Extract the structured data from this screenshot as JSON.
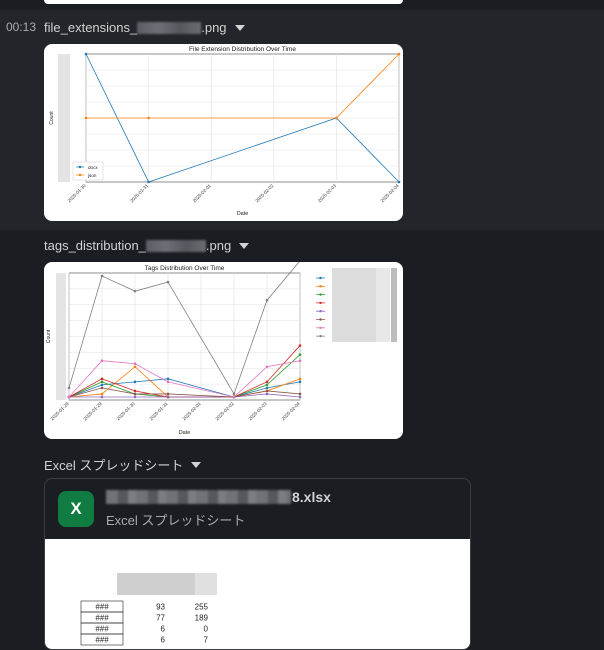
{
  "message": {
    "time": "00:13"
  },
  "files": [
    {
      "name_prefix": "file_extensions_",
      "name_suffix": ".png"
    },
    {
      "name_prefix": "tags_distribution_",
      "name_suffix": ".png"
    }
  ],
  "excel_section_label": "Excel スプレッドシート",
  "excel_card": {
    "name_suffix": "8.xlsx",
    "type_label": "Excel スプレッドシート",
    "icon_letter": "X"
  },
  "excel_preview": {
    "rows": [
      {
        "a": "###",
        "b": "93",
        "c": "255"
      },
      {
        "a": "###",
        "b": "77",
        "c": "189"
      },
      {
        "a": "###",
        "b": "6",
        "c": "0"
      },
      {
        "a": "###",
        "b": "6",
        "c": "7"
      }
    ]
  },
  "colors": {
    "blue": "#1f77b4",
    "orange": "#ff7f0e",
    "green": "#2ca02c",
    "red": "#d62728",
    "purple": "#9467bd",
    "brown": "#8c564b",
    "pink": "#e377c2",
    "gray": "#7f7f7f",
    "excel": "#107c41"
  },
  "chart_data": [
    {
      "type": "line",
      "title": "File Extension Distribution Over Time",
      "xlabel": "Date",
      "ylabel": "Count",
      "x": [
        "2025-01-30",
        "2025-01-31",
        "2025-02-01",
        "2025-02-02",
        "2025-02-03",
        "2025-02-04"
      ],
      "grid": true,
      "legend_position": "bottom-left",
      "ylim": [
        0,
        10
      ],
      "series": [
        {
          "name": "docx",
          "color": "#1f77b4",
          "points": [
            [
              0,
              10
            ],
            [
              1,
              0
            ],
            [
              4,
              5
            ],
            [
              5,
              0
            ]
          ]
        },
        {
          "name": "json",
          "color": "#ff7f0e",
          "points": [
            [
              0,
              5
            ],
            [
              1,
              5
            ],
            [
              4,
              5
            ],
            [
              5,
              10
            ]
          ]
        }
      ]
    },
    {
      "type": "line",
      "title": "Tags Distribution Over Time",
      "xlabel": "Date",
      "ylabel": "Count",
      "x": [
        "2025-01-28",
        "2025-01-29",
        "2025-01-30",
        "2025-01-31",
        "2025-02-01",
        "2025-02-02",
        "2025-02-03",
        "2025-02-04"
      ],
      "grid": true,
      "legend_position": "outside-right",
      "ylim": [
        0,
        42
      ],
      "series": [
        {
          "color": "#1f77b4",
          "points": [
            [
              0,
              1
            ],
            [
              1,
              5
            ],
            [
              2,
              6
            ],
            [
              3,
              7
            ],
            [
              5,
              1
            ],
            [
              6,
              4
            ],
            [
              7,
              6
            ]
          ]
        },
        {
          "color": "#ff7f0e",
          "points": [
            [
              0,
              1
            ],
            [
              1,
              2
            ],
            [
              2,
              11
            ],
            [
              3,
              1
            ],
            [
              5,
              1
            ],
            [
              6,
              3
            ],
            [
              7,
              7
            ]
          ]
        },
        {
          "color": "#2ca02c",
          "points": [
            [
              0,
              1
            ],
            [
              1,
              6
            ],
            [
              2,
              2
            ],
            [
              3,
              1
            ],
            [
              5,
              1
            ],
            [
              6,
              5
            ],
            [
              7,
              15
            ]
          ]
        },
        {
          "color": "#d62728",
          "points": [
            [
              0,
              1
            ],
            [
              1,
              7
            ],
            [
              2,
              3
            ],
            [
              3,
              1
            ],
            [
              5,
              1
            ],
            [
              6,
              6
            ],
            [
              7,
              18
            ]
          ]
        },
        {
          "color": "#9467bd",
          "points": [
            [
              0,
              1
            ],
            [
              1,
              1
            ],
            [
              2,
              1
            ],
            [
              3,
              1
            ],
            [
              5,
              1
            ],
            [
              6,
              2
            ],
            [
              7,
              1
            ]
          ]
        },
        {
          "color": "#8c564b",
          "points": [
            [
              0,
              1
            ],
            [
              1,
              4
            ],
            [
              2,
              2
            ],
            [
              3,
              2
            ],
            [
              5,
              1
            ],
            [
              6,
              3
            ],
            [
              7,
              2
            ]
          ]
        },
        {
          "color": "#e377c2",
          "points": [
            [
              0,
              1
            ],
            [
              1,
              13
            ],
            [
              2,
              12
            ],
            [
              3,
              6
            ],
            [
              5,
              1
            ],
            [
              6,
              11
            ],
            [
              7,
              13
            ]
          ]
        },
        {
          "color": "#7f7f7f",
          "points": [
            [
              0,
              4
            ],
            [
              1,
              41
            ],
            [
              2,
              36
            ],
            [
              3,
              39
            ],
            [
              5,
              2
            ],
            [
              6,
              33
            ],
            [
              7,
              46
            ]
          ]
        }
      ]
    }
  ]
}
